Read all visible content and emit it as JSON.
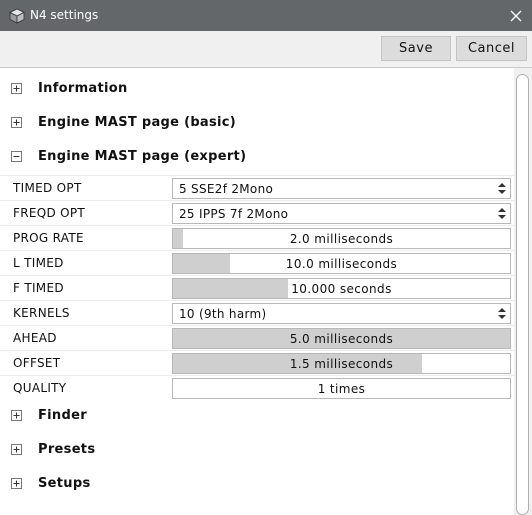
{
  "window": {
    "title": "N4 settings",
    "app_icon": "cube-icon",
    "close_icon": "close-icon"
  },
  "toolbar": {
    "save_label": "Save",
    "cancel_label": "Cancel"
  },
  "sections": [
    {
      "label": "Information",
      "expanded": false
    },
    {
      "label": "Engine MAST page (basic)",
      "expanded": false
    },
    {
      "label": "Engine MAST page (expert)",
      "expanded": true
    },
    {
      "label": "Finder",
      "expanded": false
    },
    {
      "label": "Presets",
      "expanded": false
    },
    {
      "label": "Setups",
      "expanded": false
    }
  ],
  "expert_rows": [
    {
      "label": "TIMED OPT",
      "type": "dropdown",
      "value": "5 SSE2f 2Mono"
    },
    {
      "label": "FREQD OPT",
      "type": "dropdown",
      "value": "25 IPPS 7f 2Mono"
    },
    {
      "label": "PROG RATE",
      "type": "slider",
      "value": "2.0 milliseconds",
      "fill_fraction": 0.03
    },
    {
      "label": "L TIMED",
      "type": "slider",
      "value": "10.0 milliseconds",
      "fill_fraction": 0.17
    },
    {
      "label": "F TIMED",
      "type": "slider",
      "value": "10.000 seconds",
      "fill_fraction": 0.34
    },
    {
      "label": "KERNELS",
      "type": "dropdown",
      "value": "10 (9th harm)"
    },
    {
      "label": "AHEAD",
      "type": "slider",
      "value": "5.0 milliseconds",
      "fill_fraction": 1.0
    },
    {
      "label": "OFFSET",
      "type": "slider",
      "value": "1.5 milliseconds",
      "fill_fraction": 0.74
    },
    {
      "label": "QUALITY",
      "type": "slider",
      "value": "1 times",
      "fill_fraction": 0.0
    }
  ],
  "colors": {
    "titlebar": "#63676a",
    "slider_fill": "#cfcfcf",
    "button": "#dcdcdc"
  }
}
